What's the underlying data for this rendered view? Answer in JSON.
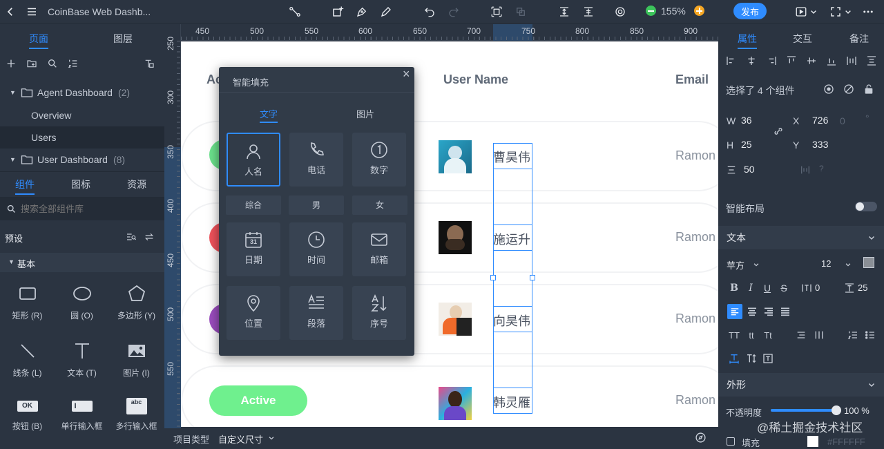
{
  "app": {
    "title": "CoinBase Web Dashb...",
    "zoom": "155%",
    "publish_label": "发布"
  },
  "left_panel": {
    "tabs": [
      "页面",
      "图层"
    ],
    "tree": [
      {
        "label": "Agent Dashboard",
        "count": "(2)"
      },
      {
        "label": "Overview"
      },
      {
        "label": "Users"
      },
      {
        "label": "User Dashboard",
        "count": "(8)"
      }
    ],
    "lib_tabs": [
      "组件",
      "图标",
      "资源"
    ],
    "search_placeholder": "搜索全部组件库",
    "preset_label": "预设",
    "basic_label": "基本",
    "components": [
      {
        "label": "矩形 (R)",
        "icon": "rectangle-icon"
      },
      {
        "label": "圆 (O)",
        "icon": "ellipse-icon"
      },
      {
        "label": "多边形 (Y)",
        "icon": "polygon-icon"
      },
      {
        "label": "线条 (L)",
        "icon": "line-icon"
      },
      {
        "label": "文本 (T)",
        "icon": "text-icon"
      },
      {
        "label": "图片 (I)",
        "icon": "image-icon"
      },
      {
        "label": "按钮 (B)",
        "icon": "button-icon",
        "glyph": "OK"
      },
      {
        "label": "单行输入框",
        "icon": "single-input-icon",
        "glyph": "I"
      },
      {
        "label": "多行输入框",
        "icon": "multi-input-icon",
        "glyph": "abc"
      }
    ]
  },
  "ruler": {
    "top": [
      "450",
      "500",
      "550",
      "600",
      "650",
      "700",
      "750",
      "800",
      "850",
      "900"
    ],
    "left": [
      "250",
      "300",
      "350",
      "400",
      "450",
      "500",
      "550"
    ]
  },
  "canvas": {
    "headers": {
      "col1": "Ac",
      "user_name": "User Name",
      "email": "Email"
    },
    "rows": [
      {
        "pill_color": "#6ce38d",
        "name": "曹昊伟",
        "email": "Ramon"
      },
      {
        "pill_color": "#f0525b",
        "name": "施运升",
        "email": "Ramon"
      },
      {
        "pill_color": "#9b4dbf",
        "name": "向昊伟",
        "email": "Ramon"
      },
      {
        "pill_color": "#6ff08e",
        "name": "韩灵雁",
        "email": "Ramon",
        "status": "Active"
      }
    ]
  },
  "bottom_bar": {
    "label": "项目类型",
    "value": "自定义尺寸"
  },
  "popup": {
    "title": "智能填充",
    "tabs": [
      "文字",
      "图片"
    ],
    "tiles_row1": [
      {
        "label": "人名",
        "icon": "person-icon"
      },
      {
        "label": "电话",
        "icon": "phone-icon"
      },
      {
        "label": "数字",
        "icon": "number-icon"
      }
    ],
    "chips": [
      "综合",
      "男",
      "女"
    ],
    "tiles_row2": [
      {
        "label": "日期",
        "icon": "calendar-icon",
        "glyph": "31"
      },
      {
        "label": "时间",
        "icon": "clock-icon"
      },
      {
        "label": "邮箱",
        "icon": "mail-icon"
      }
    ],
    "tiles_row3": [
      {
        "label": "位置",
        "icon": "location-icon"
      },
      {
        "label": "段落",
        "icon": "paragraph-icon"
      },
      {
        "label": "序号",
        "icon": "sort-icon"
      }
    ]
  },
  "right_panel": {
    "tabs": [
      "属性",
      "交互",
      "备注"
    ],
    "selection_text": "选择了 4 个组件",
    "w_label": "W",
    "w_value": "36",
    "h_label": "H",
    "h_value": "25",
    "x_label": "X",
    "x_value": "726",
    "y_label": "Y",
    "y_value": "333",
    "rot_value": "0",
    "deg": "°",
    "spacing_value": "50",
    "question": "?",
    "smart_layout": "智能布局",
    "text_section": "文本",
    "font_name": "苹方",
    "font_size": "12",
    "letter_spacing": "0",
    "line_height": "25",
    "shape_section": "外形",
    "opacity_label": "不透明度",
    "opacity_value": "100 %",
    "opacity": 1.0,
    "fill_label": "填充",
    "fill_hex": "#FFFFFF",
    "watermark": "@稀土掘金技术社区"
  },
  "colors": {
    "accent": "#2f8cff",
    "panel_bg": "#2b3441",
    "zoom_minus": "#3cc45b",
    "zoom_plus": "#f5a623"
  }
}
